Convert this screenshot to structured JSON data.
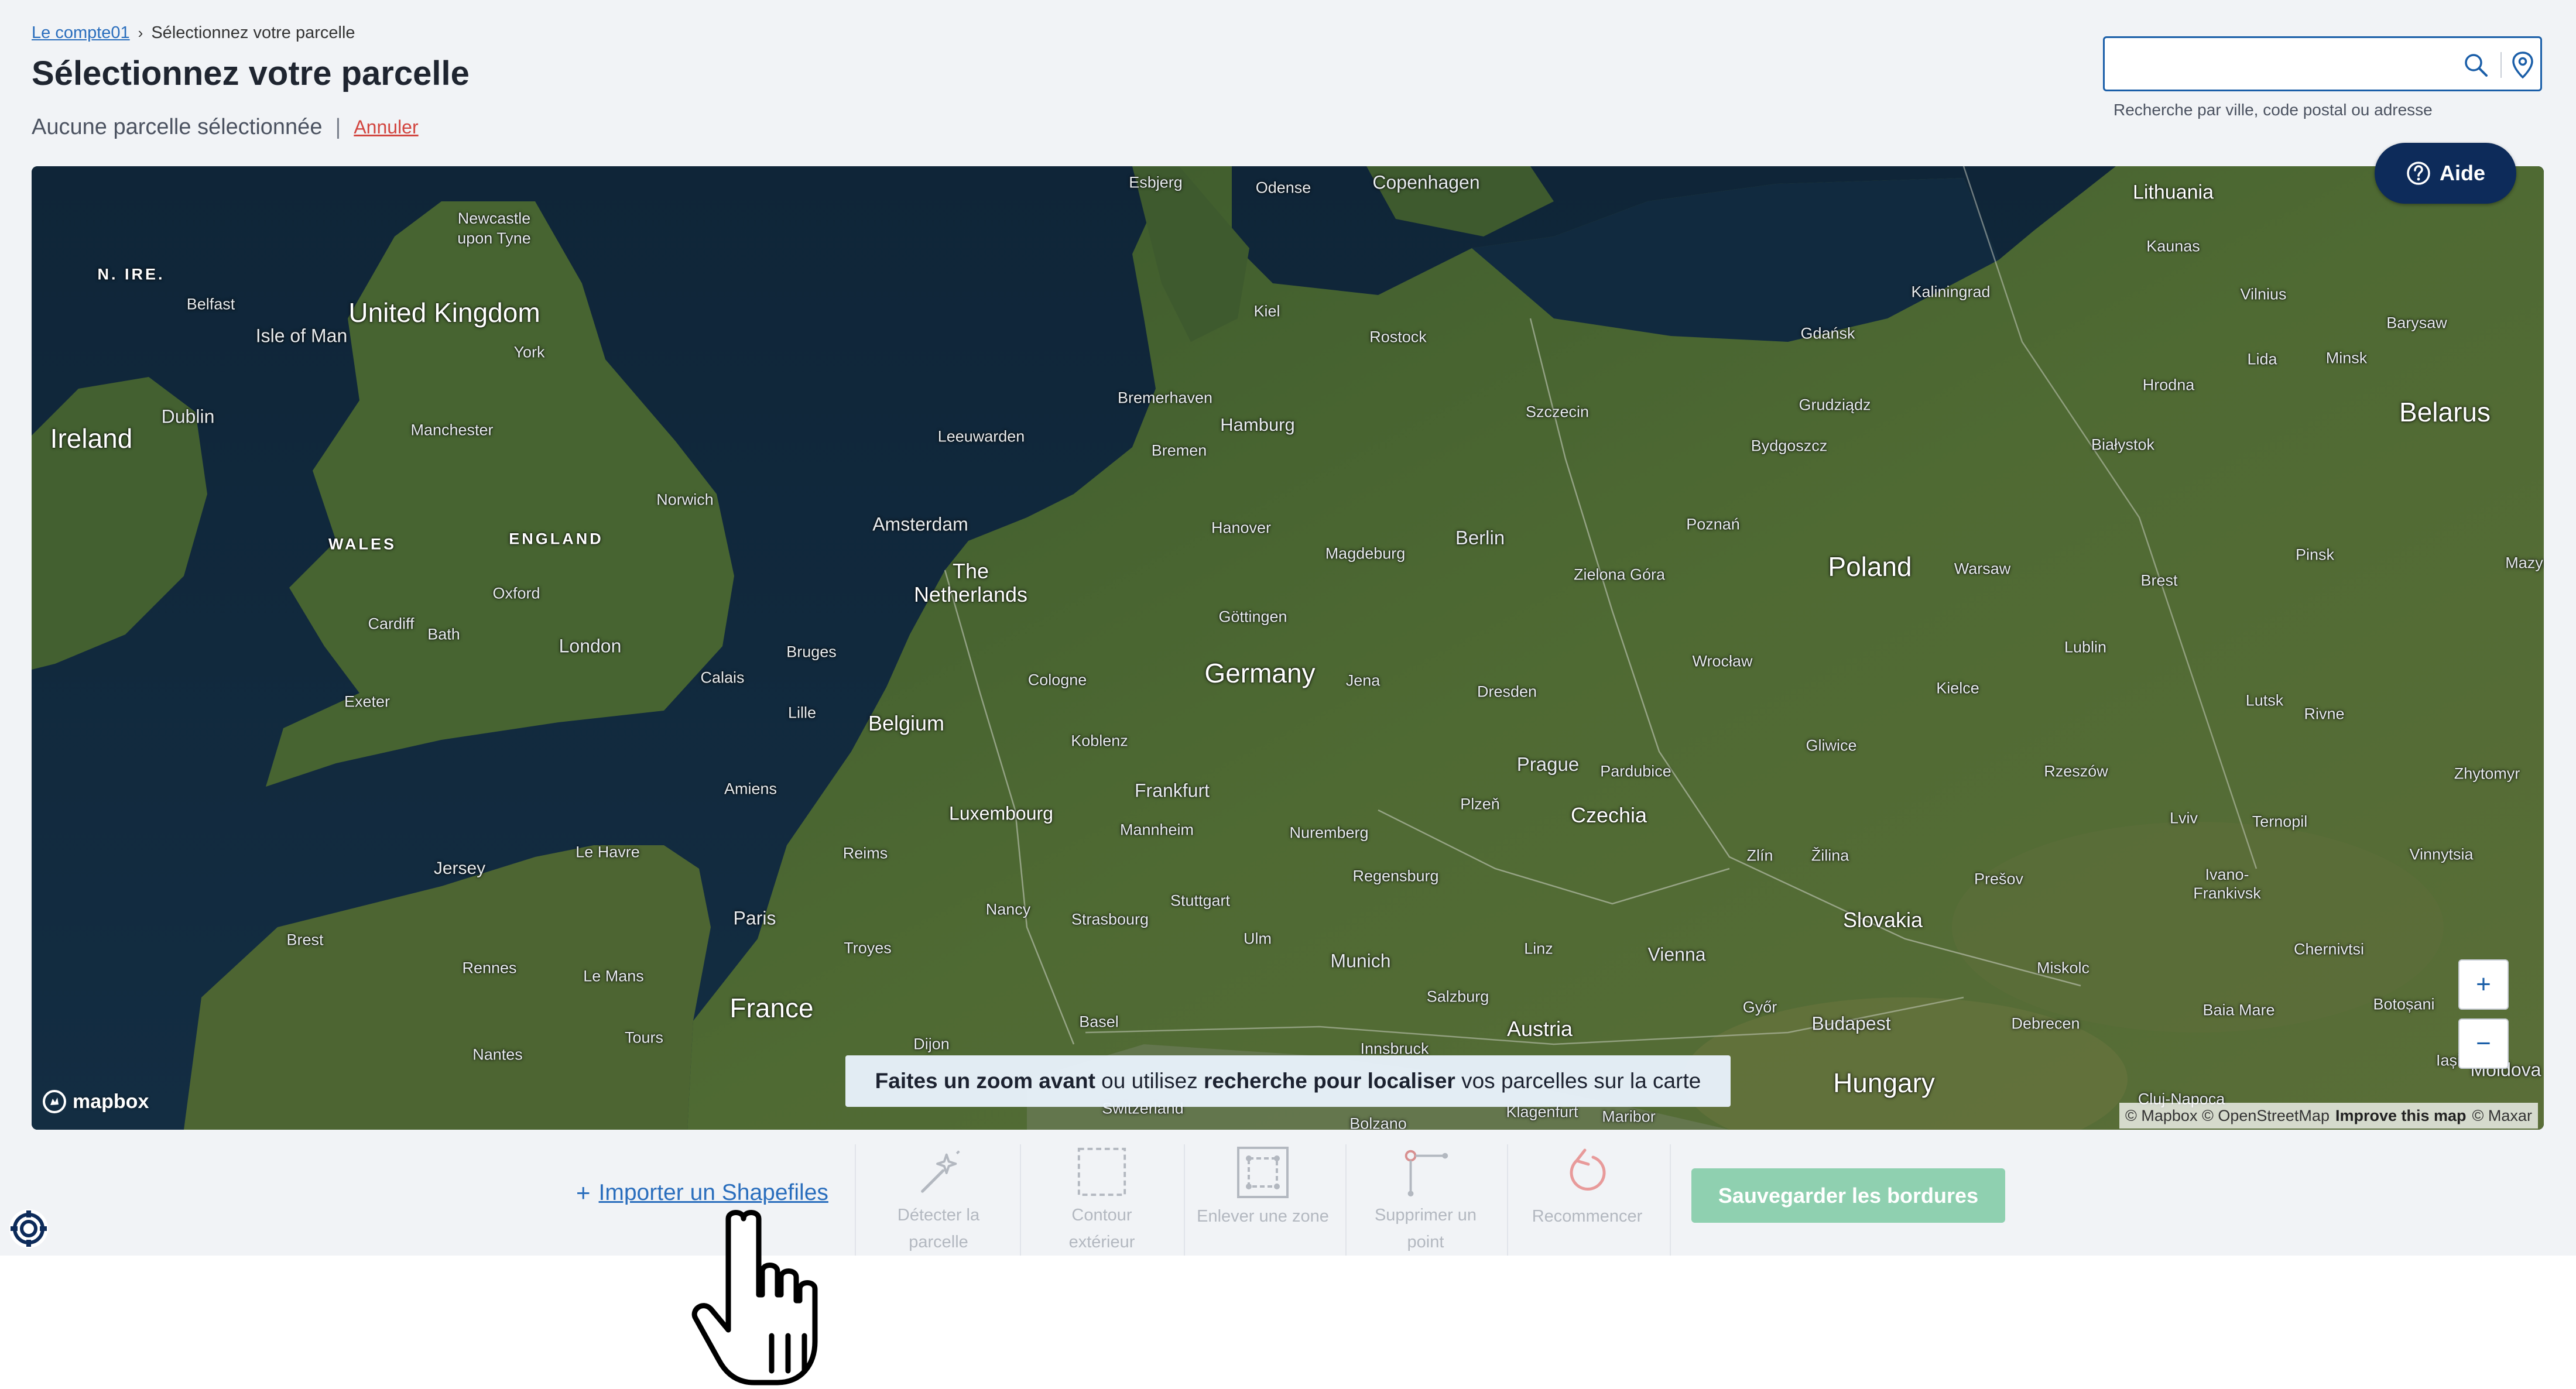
{
  "breadcrumb": {
    "parent": "Le compte01",
    "separator": "›",
    "current": "Sélectionnez votre parcelle"
  },
  "header": {
    "title": "Sélectionnez votre parcelle",
    "selection_status": "Aucune parcelle sélectionnée",
    "separator": "|",
    "cancel_label": "Annuler"
  },
  "search": {
    "value": "",
    "placeholder": "",
    "hint": "Recherche par ville, code postal ou adresse"
  },
  "help": {
    "label": "Aide"
  },
  "map": {
    "zoom_in_label": "+",
    "zoom_out_label": "−",
    "hint_part1": "Faites un zoom avant",
    "hint_part2": " ou utilisez ",
    "hint_part3": "recherche pour localiser",
    "hint_part4": " vos parcelles sur la carte",
    "logo_label": "mapbox",
    "attribution": "© Mapbox © OpenStreetMap",
    "improve_label": "Improve this map",
    "attribution_maxar": "© Maxar",
    "countries": [
      "United Kingdom",
      "Ireland",
      "The Netherlands",
      "Belgium",
      "Germany",
      "France",
      "Luxembourg",
      "Poland",
      "Czechia",
      "Slovakia",
      "Austria",
      "Hungary",
      "Lithuania",
      "Belarus"
    ],
    "regions": [
      "N. IRE.",
      "WALES",
      "ENGLAND"
    ],
    "cities": [
      "Esbjerg",
      "Odense",
      "Copenhagen",
      "Newcastle upon Tyne",
      "Belfast",
      "Isle of Man",
      "York",
      "Dublin",
      "Manchester",
      "Norwich",
      "Oxford",
      "Cardiff",
      "Bath",
      "London",
      "Exeter",
      "Calais",
      "Bruges",
      "Lille",
      "Amsterdam",
      "Leeuwarden",
      "Bremerhaven",
      "Bremen",
      "Hamburg",
      "Kiel",
      "Rostock",
      "Szczecin",
      "Hanover",
      "Magdeburg",
      "Berlin",
      "Göttingen",
      "Cologne",
      "Jena",
      "Dresden",
      "Koblenz",
      "Frankfurt",
      "Mannheim",
      "Nuremberg",
      "Regensburg",
      "Stuttgart",
      "Ulm",
      "Munich",
      "Strasbourg",
      "Reims",
      "Nancy",
      "Paris",
      "Troyes",
      "Amiens",
      "Le Havre",
      "Jersey",
      "Brest",
      "Rennes",
      "Le Mans",
      "Nantes",
      "Tours",
      "Dijon",
      "Basel",
      "Innsbruck",
      "Bolzano",
      "Salzburg",
      "Linz",
      "Vienna",
      "Prague",
      "Pardubice",
      "Plzeň",
      "Zlín",
      "Žilina",
      "Győr",
      "Budapest",
      "Debrecen",
      "Maribor",
      "Klagenfurt",
      "Gdańsk",
      "Kaliningrad",
      "Kaunas",
      "Vilnius",
      "Grudziądz",
      "Bydgoszcz",
      "Białystok",
      "Hrodna",
      "Lida",
      "Minsk",
      "Barysaw",
      "Poznań",
      "Zielona Góra",
      "Warsaw",
      "Brest",
      "Pinsk",
      "Mazyr",
      "Wrocław",
      "Gliwice",
      "Kielce",
      "Lublin",
      "Lutsk",
      "Rivne",
      "Rzeszów",
      "Zhytomyr",
      "Prešov",
      "Lviv",
      "Ternopil",
      "Vinnytsia",
      "Ivano-Frankivsk",
      "Chernivtsi",
      "Miskolc",
      "Baia Mare",
      "Botoșani",
      "Iași",
      "Cluj-Napoca",
      "Moldova",
      "Switzerland",
      "Kaunas"
    ]
  },
  "toolbar": {
    "import_plus": "+",
    "import_label": "Importer un Shapefiles",
    "tools": [
      {
        "label_line1": "Détecter la",
        "label_line2": "parcelle"
      },
      {
        "label_line1": "Contour",
        "label_line2": "extérieur"
      },
      {
        "label_line1": "Enlever une zone",
        "label_line2": ""
      },
      {
        "label_line1": "Supprimer un",
        "label_line2": "point"
      },
      {
        "label_line1": "Recommencer",
        "label_line2": ""
      }
    ],
    "save_label": "Sauvegarder les bordures"
  },
  "colors": {
    "primary": "#1a5ea8",
    "help_bg": "#0d2b5a",
    "cancel": "#d2453f",
    "save_disabled": "#8fd0b0",
    "tool_disabled": "#b3b8c0"
  },
  "icons": [
    "search-icon",
    "location-pin-icon",
    "help-circle-icon",
    "magic-wand-icon",
    "dashed-rectangle-icon",
    "remove-area-icon",
    "delete-point-icon",
    "restart-icon",
    "accessibility-icon",
    "hand-pointer-cursor-icon",
    "mapbox-logo-icon"
  ]
}
